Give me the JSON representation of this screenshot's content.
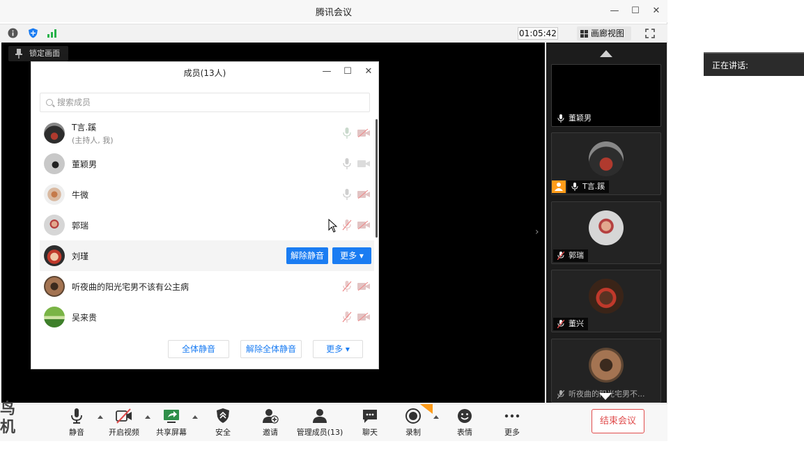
{
  "window": {
    "title": "腾讯会议"
  },
  "infobar": {
    "timer": "01:05:42",
    "gallery_label": "画廊视图"
  },
  "video": {
    "lock_label": "锁定画面"
  },
  "speaking": {
    "label": "正在讲话:"
  },
  "members_dialog": {
    "title": "成员(13人)",
    "search_placeholder": "搜索成员",
    "members": [
      {
        "name": "T言.蹊",
        "sub": "(主持人, 我)",
        "mic": "on",
        "cam": "off"
      },
      {
        "name": "董颖男",
        "mic": "on",
        "cam": "off"
      },
      {
        "name": "牛微",
        "mic": "on",
        "cam": "off"
      },
      {
        "name": "郭瑞",
        "mic": "muted",
        "cam": "off"
      },
      {
        "name": "刘瑾",
        "unmute_label": "解除静音",
        "more_label": "更多 ▾"
      },
      {
        "name": "听夜曲的阳光宅男不该有公主病",
        "mic": "muted",
        "cam": "off"
      },
      {
        "name": "吴来贵",
        "mic": "muted",
        "cam": "off"
      }
    ],
    "footer": {
      "mute_all": "全体静音",
      "unmute_all": "解除全体静音",
      "more": "更多 ▾"
    }
  },
  "gallery": {
    "tiles": [
      {
        "name": "董颖男"
      },
      {
        "name": "T言.蹊"
      },
      {
        "name": "郭瑞"
      },
      {
        "name": "董兴"
      },
      {
        "name": "听夜曲的阳光宅男不..."
      }
    ]
  },
  "toolbar": {
    "mute": "静音",
    "video": "开启视频",
    "share": "共享屏幕",
    "security": "安全",
    "invite": "邀请",
    "manage": "管理成员(13)",
    "chat": "聊天",
    "record": "录制",
    "reactions": "表情",
    "more": "更多",
    "end": "结束会议"
  },
  "watermark": {
    "line1": "鸟",
    "line2": "机"
  }
}
